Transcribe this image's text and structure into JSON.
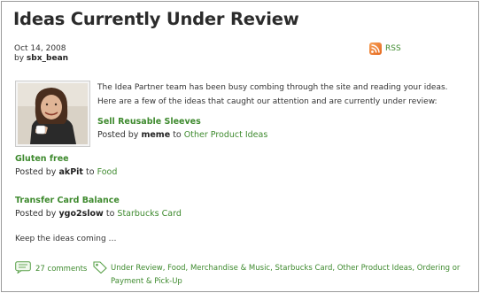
{
  "post": {
    "title": "Ideas Currently Under Review",
    "date": "Oct 14, 2008",
    "by_prefix": "by",
    "author": "sbx_bean",
    "rss_label": "RSS",
    "intro_line1": "The Idea Partner team has been busy combing through the site and reading your ideas.",
    "intro_line2": "Here are a few of the ideas that caught our attention and are currently under review:"
  },
  "ideas": [
    {
      "title": "Sell Reusable Sleeves",
      "posted_by_prefix": "Posted by",
      "user": "meme",
      "to": "to",
      "category": "Other Product Ideas"
    },
    {
      "title": "Gluten free",
      "posted_by_prefix": "Posted by",
      "user": "akPit",
      "to": "to",
      "category": "Food"
    },
    {
      "title": "Transfer Card Balance",
      "posted_by_prefix": "Posted by",
      "user": "ygo2slow",
      "to": "to",
      "category": "Starbucks Card"
    }
  ],
  "closing": "Keep the ideas coming …",
  "footer": {
    "comments": "27 comments",
    "tags_line1": "Under Review, Food, Merchandise & Music, Starbucks Card, Other Product Ideas, Ordering or",
    "tags_line2": "Payment & Pick-Up"
  },
  "colors": {
    "link": "#3e8a2e",
    "text": "#333333",
    "border": "#9a9a9a",
    "rss": "#e5671c"
  },
  "icons": [
    "rss-icon",
    "author-photo",
    "comments-icon",
    "tag-icon"
  ]
}
